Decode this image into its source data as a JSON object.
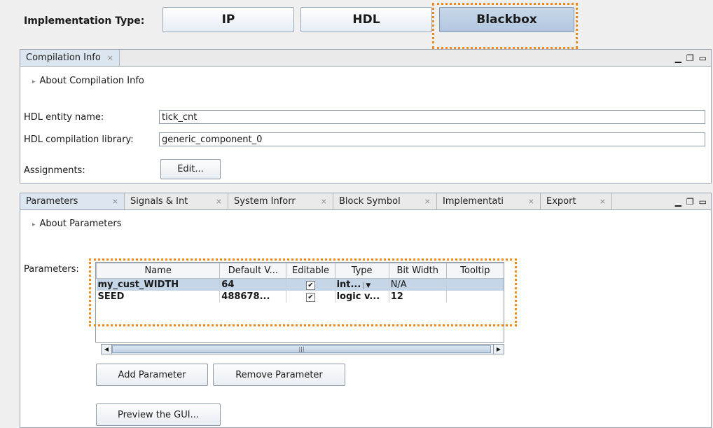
{
  "implementation": {
    "label": "Implementation Type:",
    "options": [
      "IP",
      "HDL",
      "Blackbox"
    ],
    "selected": "Blackbox"
  },
  "compilation_panel": {
    "tab": "Compilation Info",
    "about": "About Compilation Info",
    "entity_label": "HDL entity name:",
    "entity_value": "tick_cnt",
    "library_label": "HDL compilation library:",
    "library_value": "generic_component_0",
    "assignments_label": "Assignments:",
    "edit_button": "Edit..."
  },
  "parameters_panel": {
    "tabs": [
      "Parameters",
      "Signals & Int",
      "System Inforr",
      "Block Symbol",
      "Implementati",
      "Export"
    ],
    "about": "About Parameters",
    "params_label": "Parameters:",
    "columns": [
      "Name",
      "Default V...",
      "Editable",
      "Type",
      "Bit Width",
      "Tooltip"
    ],
    "rows": [
      {
        "name": "my_cust_WIDTH",
        "default": "64",
        "editable": true,
        "type": "int...",
        "bit_width": "N/A",
        "tooltip": ""
      },
      {
        "name": "SEED",
        "default": "488678...",
        "editable": true,
        "type": "logic v...",
        "bit_width": "12",
        "tooltip": ""
      }
    ],
    "add_button": "Add Parameter",
    "remove_button": "Remove Parameter",
    "preview_button": "Preview the GUI...",
    "scroll_grip": "|||"
  },
  "icons": {
    "close_tab": "⨯",
    "minimize": "▁",
    "restore": "❐",
    "maximize": "▭",
    "expand": "▸",
    "scroll_left": "◀",
    "scroll_right": "▶",
    "dropdown": "▼",
    "check": "✔"
  },
  "colors": {
    "highlight_box": "#ef8a1e",
    "selected_row": "#c5d6e9",
    "selected_button": "#b2c7df"
  }
}
